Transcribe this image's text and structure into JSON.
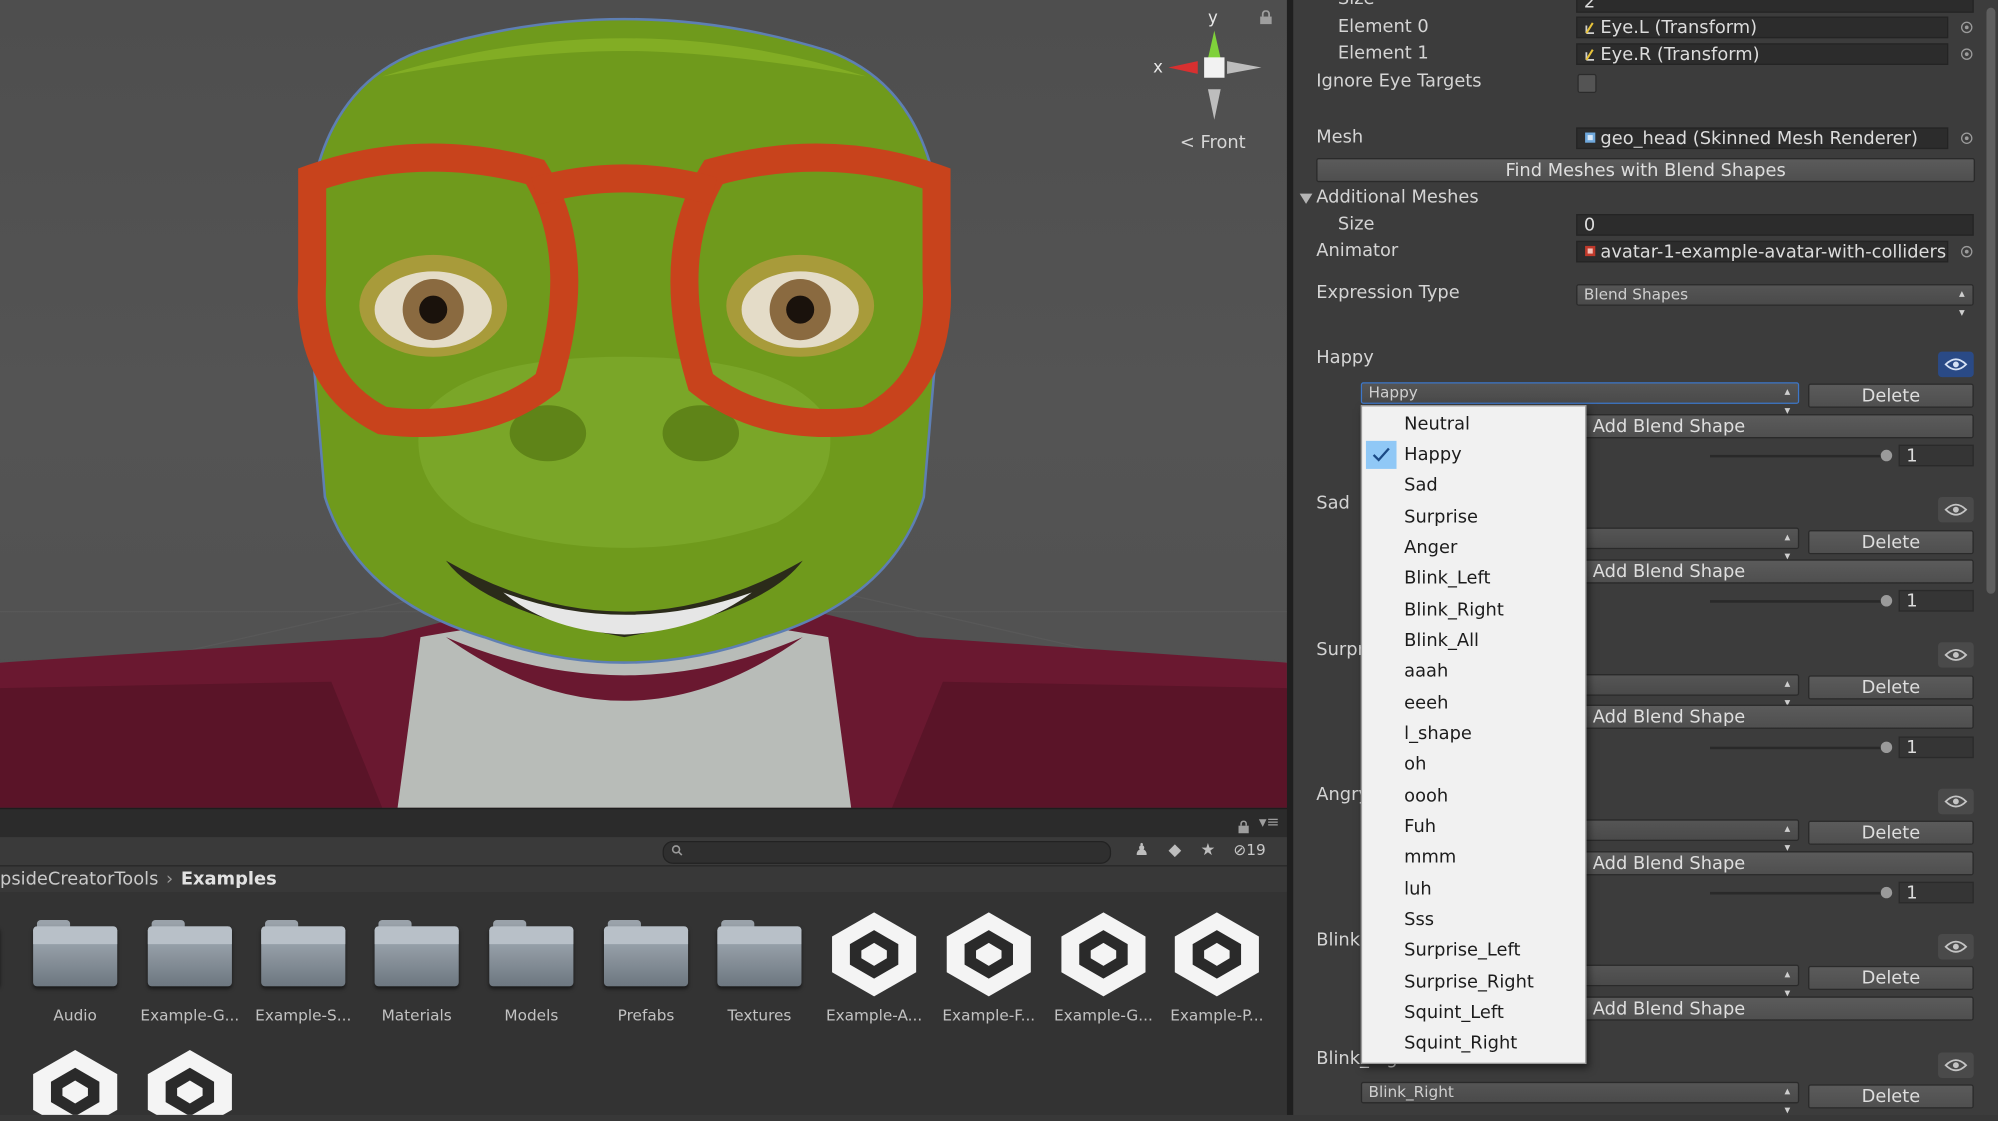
{
  "scene": {
    "gizmo_axis_y": "y",
    "gizmo_axis_x": "x",
    "view_label": "Front"
  },
  "project": {
    "hidden_count": "19",
    "breadcrumb": [
      "psideCreatorTools",
      "Examples"
    ],
    "assets": [
      {
        "label": "Audio",
        "type": "folder"
      },
      {
        "label": "Example-G...",
        "type": "folder"
      },
      {
        "label": "Example-S...",
        "type": "folder"
      },
      {
        "label": "Materials",
        "type": "folder"
      },
      {
        "label": "Models",
        "type": "folder"
      },
      {
        "label": "Prefabs",
        "type": "folder"
      },
      {
        "label": "Textures",
        "type": "folder"
      },
      {
        "label": "Example-A...",
        "type": "unity-scene"
      },
      {
        "label": "Example-F...",
        "type": "unity-scene"
      },
      {
        "label": "Example-G...",
        "type": "unity-scene"
      },
      {
        "label": "Example-P...",
        "type": "unity-scene"
      }
    ]
  },
  "inspector": {
    "size_label": "Size",
    "size_value": "2",
    "element0_label": "Element 0",
    "element0_value": "Eye.L (Transform)",
    "element1_label": "Element 1",
    "element1_value": "Eye.R (Transform)",
    "ignore_eye_targets_label": "Ignore Eye Targets",
    "mesh_label": "Mesh",
    "mesh_value": "geo_head (Skinned Mesh Renderer)",
    "find_meshes_button": "Find Meshes with Blend Shapes",
    "additional_meshes_label": "Additional Meshes",
    "additional_size_label": "Size",
    "additional_size_value": "0",
    "animator_label": "Animator",
    "animator_value": "avatar-1-example-avatar-with-colliders",
    "expression_type_label": "Expression Type",
    "expression_type_value": "Blend Shapes",
    "sections": [
      {
        "label": "Happy",
        "popup": "Happy",
        "delete": "Delete",
        "add": "Add Blend Shape",
        "value": "1"
      },
      {
        "label": "Sad",
        "popup": "",
        "delete": "Delete",
        "add": "Add Blend Shape",
        "value": "1"
      },
      {
        "label": "Surpr",
        "popup": "",
        "delete": "Delete",
        "add": "Add Blend Shape",
        "value": "1"
      },
      {
        "label": "Angry",
        "popup": "",
        "delete": "Delete",
        "add": "Add Blend Shape",
        "value": "1"
      },
      {
        "label": "Blink",
        "popup": "",
        "delete": "Delete",
        "add": "Add Blend Shape",
        "value": ""
      },
      {
        "label": "Blink_Right",
        "popup": "Blink_Right",
        "delete": "Delete",
        "add": "",
        "value": ""
      }
    ]
  },
  "dropdown": {
    "selected": "Happy",
    "options": [
      "Neutral",
      "Happy",
      "Sad",
      "Surprise",
      "Anger",
      "Blink_Left",
      "Blink_Right",
      "Blink_All",
      "aaah",
      "eeeh",
      "l_shape",
      "oh",
      "oooh",
      "Fuh",
      "mmm",
      "luh",
      "Sss",
      "Surprise_Left",
      "Surprise_Right",
      "Squint_Left",
      "Squint_Right"
    ]
  },
  "colors": {
    "accent": "#2a4a86",
    "menu_highlight": "#90c8f6",
    "glasses": "#c8431c",
    "skin": "#6e9a1e"
  }
}
